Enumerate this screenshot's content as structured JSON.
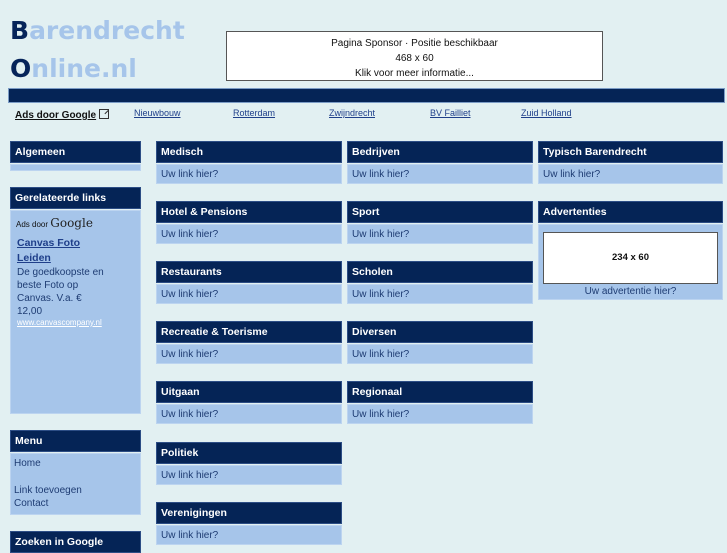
{
  "logo": {
    "line1_first": "B",
    "line1_rest": "arendrecht",
    "line2_first": "O",
    "line2_rest": "nline.nl"
  },
  "sponsor": {
    "line1": "Pagina Sponsor · Positie beschikbaar",
    "line2": "468 x 60",
    "line3": "Klik voor meer informatie..."
  },
  "topLinks": {
    "ads_label": "Ads door Google",
    "items": [
      "Nieuwbouw",
      "Rotterdam",
      "Zwijndrecht",
      "BV Failliet",
      "Zuid Holland"
    ]
  },
  "left": {
    "algemeen": {
      "title": "Algemeen"
    },
    "gerelateerde": {
      "title": "Gerelateerde links",
      "ads_prefix": "Ads door",
      "ads_brand": "Google",
      "ad_title_1": "Canvas Foto",
      "ad_title_2": "Leiden",
      "ad_text_1": "De goedkoopste en",
      "ad_text_2": "beste Foto op",
      "ad_text_3": "Canvas. V.a. €",
      "ad_text_4": "12,00",
      "ad_url": "www.canvascompany.nl"
    },
    "menu": {
      "title": "Menu",
      "items": [
        "Home",
        "Link toevoegen",
        "Contact"
      ]
    },
    "zoeken": {
      "title": "Zoeken in Google"
    }
  },
  "categories": {
    "col1": [
      {
        "title": "Medisch",
        "link": "Uw link hier?"
      },
      {
        "title": "Hotel & Pensions",
        "link": "Uw link hier?"
      },
      {
        "title": "Restaurants",
        "link": "Uw link hier?"
      },
      {
        "title": "Recreatie & Toerisme",
        "link": "Uw link hier?"
      },
      {
        "title": "Uitgaan",
        "link": "Uw link hier?"
      },
      {
        "title": "Politiek",
        "link": "Uw link hier?"
      },
      {
        "title": "Verenigingen",
        "link": "Uw link hier?"
      }
    ],
    "col2": [
      {
        "title": "Bedrijven",
        "link": "Uw link hier?"
      },
      {
        "title": "Sport",
        "link": "Uw link hier?"
      },
      {
        "title": "Scholen",
        "link": "Uw link hier?"
      },
      {
        "title": "Diversen",
        "link": "Uw link hier?"
      },
      {
        "title": "Regionaal",
        "link": "Uw link hier?"
      }
    ]
  },
  "right": {
    "typisch": {
      "title": "Typisch Barendrecht",
      "link": "Uw link hier?"
    },
    "advertenties": {
      "title": "Advertenties",
      "banner": "234 x 60",
      "caption": "Uw advertentie hier?"
    }
  }
}
